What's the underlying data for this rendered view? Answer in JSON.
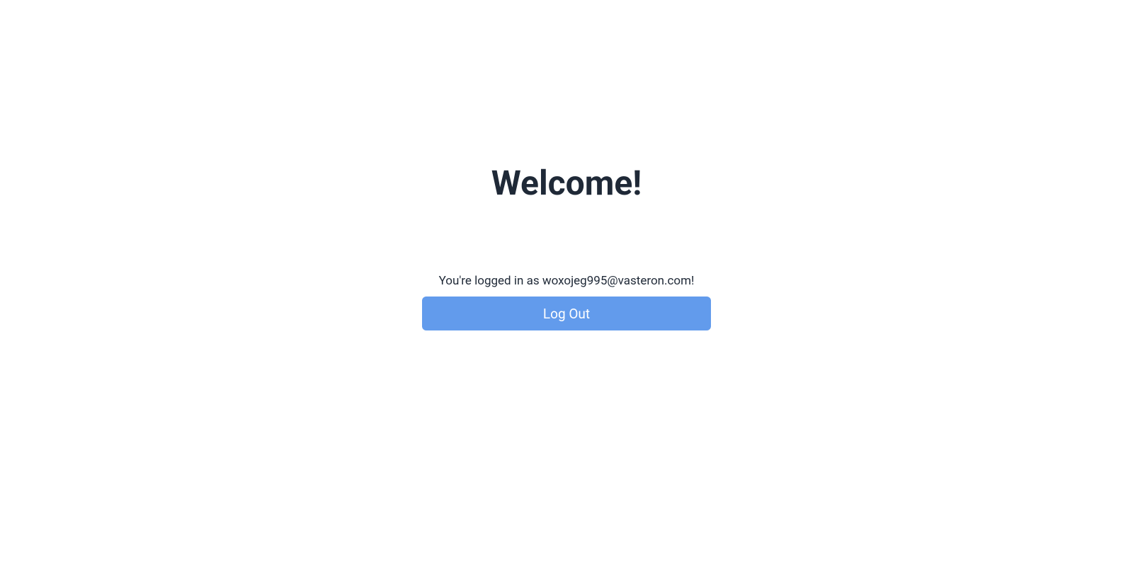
{
  "heading": "Welcome!",
  "status_prefix": "You're logged in as ",
  "user_email": "woxojeg995@vasteron.com",
  "status_suffix": "!",
  "logout_label": "Log Out"
}
